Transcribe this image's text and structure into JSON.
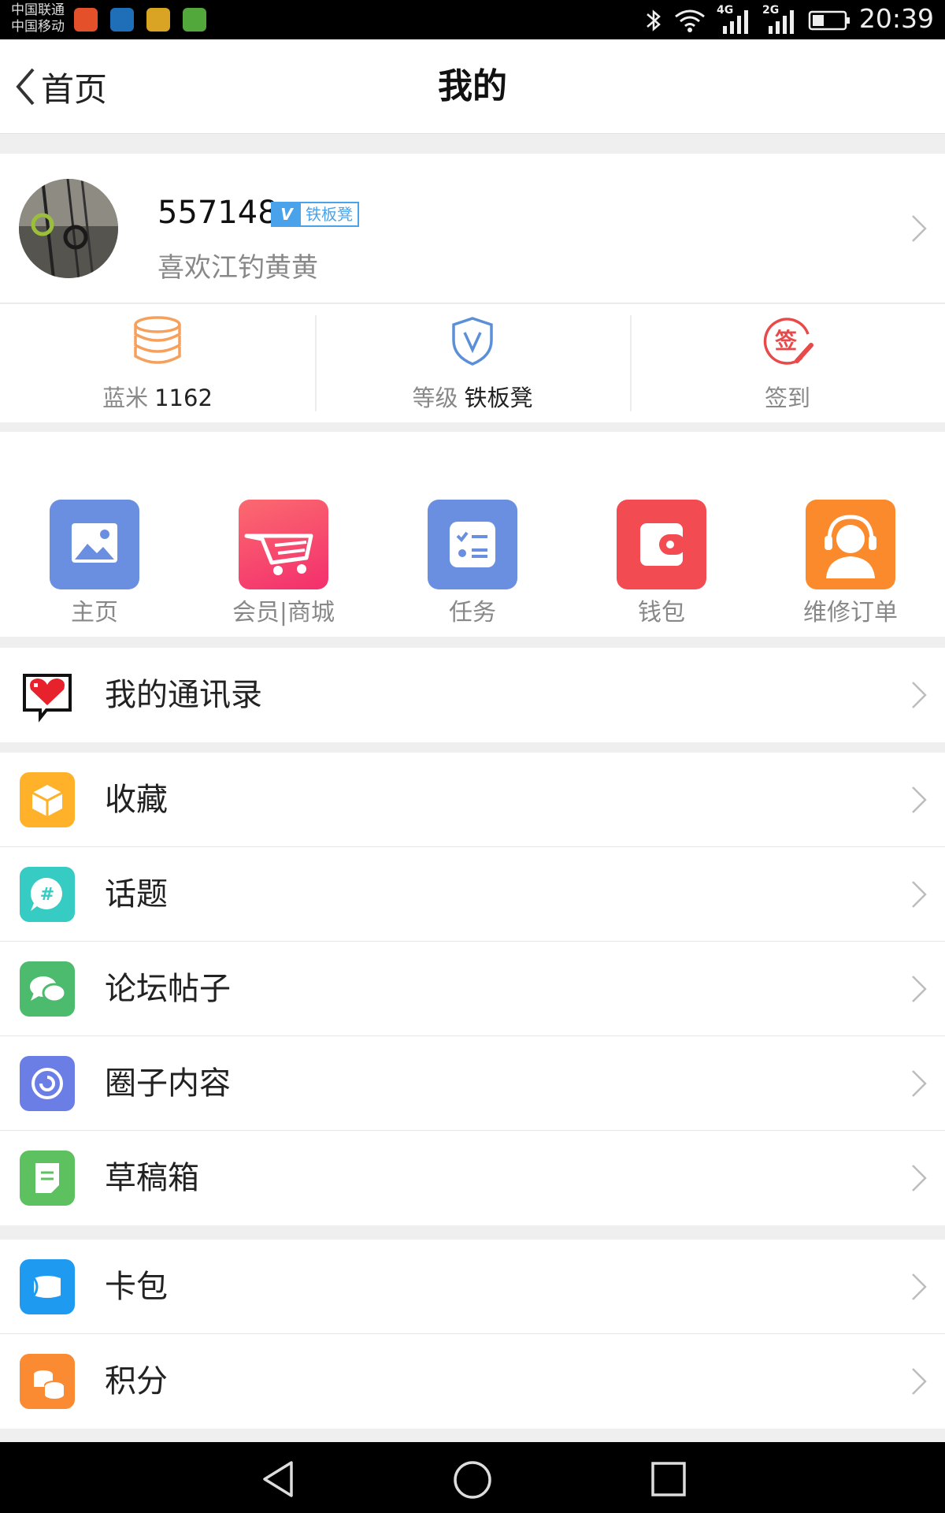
{
  "status_bar": {
    "carrier_1": "中国联通",
    "carrier_2": "中国移动",
    "net_4g": "4G",
    "net_2g": "2G",
    "time": "20:39"
  },
  "header": {
    "back_label": "首页",
    "title": "我的"
  },
  "profile": {
    "user_id": "557148",
    "level_badge": "铁板凳",
    "signature": "喜欢江钓黄黄"
  },
  "stats": {
    "points_label": "蓝米",
    "points_value": "1162",
    "level_label": "等级",
    "level_value": "铁板凳",
    "checkin_label": "签到",
    "checkin_icon_char": "签"
  },
  "quick_apps": [
    {
      "label": "主页",
      "icon": "image-icon",
      "color": "#6b8fe0"
    },
    {
      "label": "会员|商城",
      "icon": "cart-icon",
      "color": "#f6456d"
    },
    {
      "label": "任务",
      "icon": "task-icon",
      "color": "#6b8fe0"
    },
    {
      "label": "钱包",
      "icon": "wallet-icon",
      "color": "#f24b52"
    },
    {
      "label": "维修订单",
      "icon": "headset-icon",
      "color": "#fb8a2d"
    }
  ],
  "menu": {
    "contacts": "我的通讯录",
    "favorites": "收藏",
    "topics": "话题",
    "forum_posts": "论坛帖子",
    "circle_content": "圈子内容",
    "drafts": "草稿箱",
    "card_wallet": "卡包",
    "points": "积分"
  },
  "colors": {
    "favorites": "#ffb12a",
    "topics": "#36cbc3",
    "forum_posts": "#4dbb6d",
    "circle_content": "#6b7ee6",
    "drafts": "#5cc15e",
    "card_wallet": "#1e9bf0",
    "points": "#fb8b32"
  }
}
